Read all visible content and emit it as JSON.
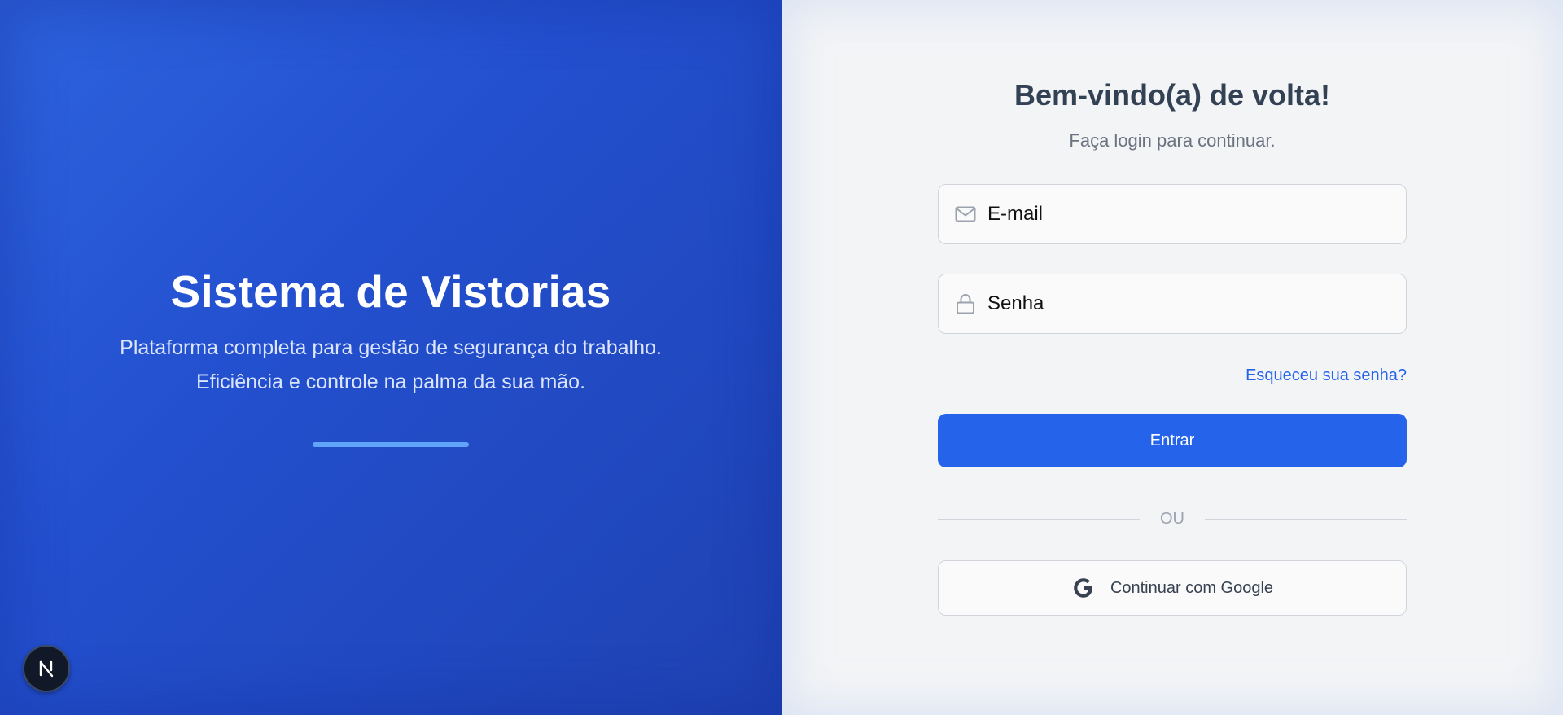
{
  "left": {
    "title": "Sistema de Vistorias",
    "description": "Plataforma completa para gestão de segurança do trabalho. Eficiência e controle na palma da sua mão.",
    "accent_color": "#60a5fa",
    "gradient_colors": [
      "#2e63de",
      "#1f42b2"
    ]
  },
  "badge": {
    "letter": "N",
    "icon": "nextjs-icon"
  },
  "form": {
    "welcome": "Bem-vindo(a) de volta!",
    "subtitle": "Faça login para continuar.",
    "email": {
      "placeholder": "E-mail",
      "value": "",
      "icon": "mail-icon"
    },
    "password": {
      "placeholder": "Senha",
      "value": "",
      "icon": "lock-icon"
    },
    "forgot_label": "Esqueceu sua senha?",
    "submit_label": "Entrar",
    "divider_label": "OU",
    "google_label": "Continuar com Google",
    "google_icon": "google-icon",
    "primary_color": "#2563eb"
  }
}
